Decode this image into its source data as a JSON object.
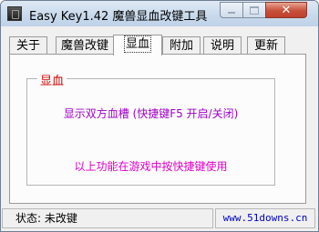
{
  "window": {
    "title": "Easy Key1.42 魔兽显血改键工具"
  },
  "tabs": [
    {
      "label": "关于"
    },
    {
      "label": "魔兽改键"
    },
    {
      "label": "显血"
    },
    {
      "label": "附加"
    },
    {
      "label": "说明"
    },
    {
      "label": "更新"
    }
  ],
  "group": {
    "label": "显血",
    "line1": "显示双方血槽 (快捷键F5 开启/关闭)",
    "line2": "以上功能在游戏中按快捷键使用"
  },
  "status": {
    "state": "状态: 未改键",
    "url": "www.51downs.cn"
  },
  "colors": {
    "group_label": "#d10000",
    "line1": "#a000c8",
    "line2": "#e000c8",
    "url": "#0000c8"
  }
}
